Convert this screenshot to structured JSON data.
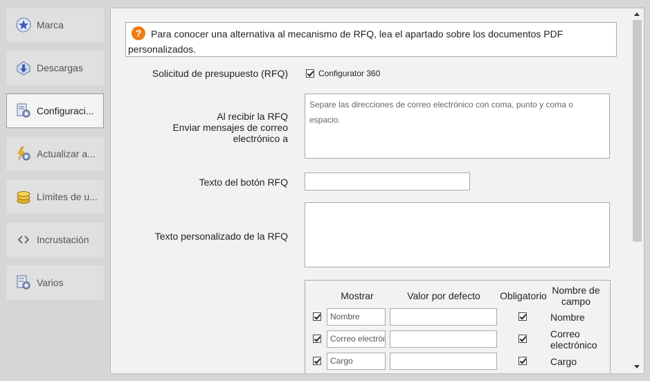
{
  "sidebar": {
    "items": [
      {
        "label": "Marca",
        "icon": "star-badge-icon"
      },
      {
        "label": "Descargas",
        "icon": "download-icon"
      },
      {
        "label": "Configuraci...",
        "icon": "settings-document-icon"
      },
      {
        "label": "Actualizar a...",
        "icon": "lightning-gear-icon"
      },
      {
        "label": "Límites de u...",
        "icon": "coins-icon"
      },
      {
        "label": "Incrustación",
        "icon": "code-brackets-icon"
      },
      {
        "label": "Varios",
        "icon": "misc-settings-icon"
      }
    ],
    "active_index": 2
  },
  "info": {
    "icon": "question-icon",
    "text": "Para conocer una alternativa al mecanismo de RFQ, lea el apartado sobre los documentos PDF personalizados."
  },
  "rfq": {
    "label": "Solicitud de presupuesto (RFQ)",
    "checkbox_label": "Configurator 360",
    "checked": true
  },
  "emails": {
    "label_line1": "Al recibir la RFQ",
    "label_line2": "Enviar mensajes de correo",
    "label_line3": "electrónico a",
    "placeholder": "Separe las direcciones de correo electrónico con coma, punto y coma o espacio."
  },
  "button_text": {
    "label": "Texto del botón RFQ",
    "value": ""
  },
  "custom_text": {
    "label": "Texto personalizado de la RFQ",
    "value": ""
  },
  "fields_table": {
    "headers": {
      "show": "Mostrar",
      "default": "Valor por defecto",
      "required": "Obligatorio",
      "field_name_line1": "Nombre de",
      "field_name_line2": "campo"
    },
    "rows": [
      {
        "show": true,
        "input": "Nombre",
        "default": "",
        "required": true,
        "name_line1": "Nombre",
        "name_line2": ""
      },
      {
        "show": true,
        "input": "Correo electrónico",
        "default": "",
        "required": true,
        "name_line1": "Correo",
        "name_line2": "electrónico"
      },
      {
        "show": true,
        "input": "Cargo",
        "default": "",
        "required": true,
        "name_line1": "Cargo",
        "name_line2": ""
      }
    ]
  }
}
